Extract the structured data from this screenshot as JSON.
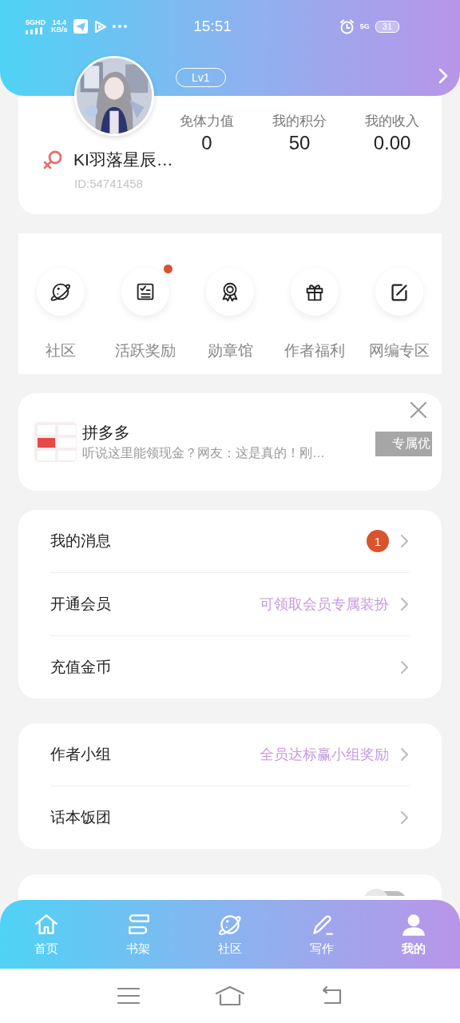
{
  "status_bar": {
    "network": "5GHD",
    "speed": "14.4",
    "speed_unit": "KB/s",
    "time": "15:51",
    "network_right": "5G",
    "battery": "31"
  },
  "profile": {
    "level": "Lv1",
    "name": "KI羽落星辰…",
    "id": "ID:54741458",
    "stats": [
      {
        "label": "免体力值",
        "value": "0"
      },
      {
        "label": "我的积分",
        "value": "50"
      },
      {
        "label": "我的收入",
        "value": "0.00"
      }
    ]
  },
  "shortcuts": [
    {
      "label": "社区",
      "kind": "planet",
      "badge": false
    },
    {
      "label": "活跃奖励",
      "kind": "checklist",
      "badge": true
    },
    {
      "label": "勋章馆",
      "kind": "medal",
      "badge": false
    },
    {
      "label": "作者福利",
      "kind": "gift",
      "badge": false
    },
    {
      "label": "网编专区",
      "kind": "edit",
      "badge": false
    }
  ],
  "ad": {
    "title": "拼多多",
    "text": "听说这里能领现金？网友：这是真的！刚…",
    "button": "专属优"
  },
  "menu_groups": [
    [
      {
        "label": "我的消息",
        "count": "1"
      },
      {
        "label": "开通会员",
        "hint": "可领取会员专属装扮"
      },
      {
        "label": "充值金币"
      }
    ],
    [
      {
        "label": "作者小组",
        "hint": "全员达标赢小组奖励"
      },
      {
        "label": "话本饭团"
      }
    ]
  ],
  "partial_setting": {
    "on": false
  },
  "tab_bar": [
    {
      "label": "首页",
      "kind": "home",
      "selected": false
    },
    {
      "label": "书架",
      "kind": "books",
      "selected": false
    },
    {
      "label": "社区",
      "kind": "planet",
      "selected": false
    },
    {
      "label": "写作",
      "kind": "pencil",
      "selected": false
    },
    {
      "label": "我的",
      "kind": "person",
      "selected": true
    }
  ]
}
